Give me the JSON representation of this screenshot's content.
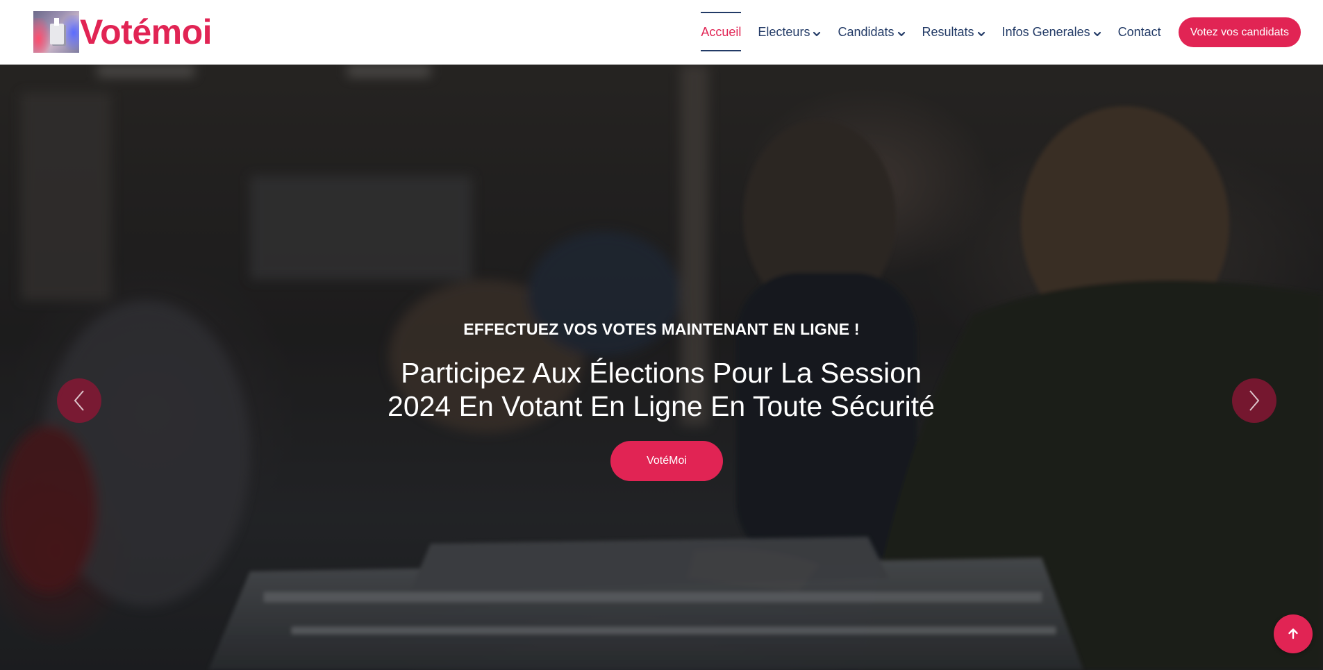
{
  "brand": {
    "name": "Votémoi",
    "logo_icon": "ballot-box-icon"
  },
  "nav": {
    "items": [
      {
        "label": "Accueil",
        "active": true,
        "dropdown": false
      },
      {
        "label": "Electeurs",
        "active": false,
        "dropdown": true
      },
      {
        "label": "Candidats",
        "active": false,
        "dropdown": true
      },
      {
        "label": "Resultats",
        "active": false,
        "dropdown": true
      },
      {
        "label": "Infos Generales",
        "active": false,
        "dropdown": true
      },
      {
        "label": "Contact",
        "active": false,
        "dropdown": false
      }
    ],
    "cta_label": "Votez vos candidats",
    "dropdown_icon": "chevron-down-icon"
  },
  "hero": {
    "subtitle": "EFFECTUEZ VOS VOTES MAINTENANT EN LIGNE !",
    "title_line1": "Participez Aux Élections Pour La Session",
    "title_line2": "2024 En Votant En Ligne En Toute Sécurité",
    "button_label": "VotéMoi",
    "prev_icon": "chevron-left-icon",
    "next_icon": "chevron-right-icon"
  },
  "back_to_top_icon": "arrow-up-icon",
  "colors": {
    "accent": "#e12454",
    "nav_text": "#223a66",
    "arrow_bg": "#8a1634"
  }
}
